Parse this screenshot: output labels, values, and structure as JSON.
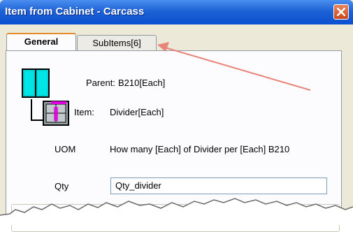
{
  "window": {
    "title": "Item from Cabinet - Carcass",
    "close_icon": "close-icon"
  },
  "tabs": [
    {
      "label": "General",
      "active": true
    },
    {
      "label": "SubItems[6]",
      "active": false
    }
  ],
  "general": {
    "parent_label": "Parent:",
    "parent_value": "B210[Each]",
    "item_label": "Item:",
    "item_value": "Divider[Each]",
    "uom_label": "UOM",
    "uom_value": "How many [Each] of Divider per [Each] B210",
    "qty_label": "Qty",
    "qty_value": "Qty_divider"
  },
  "icons": {
    "parent": "cabinet-icon",
    "item": "divider-icon",
    "annotation": "red-arrow"
  },
  "colors": {
    "title_bar": "#0a4fd0",
    "accent_tab": "#e68b2c",
    "arrow": "#e8847a",
    "cabinet": "#00c8c8"
  }
}
